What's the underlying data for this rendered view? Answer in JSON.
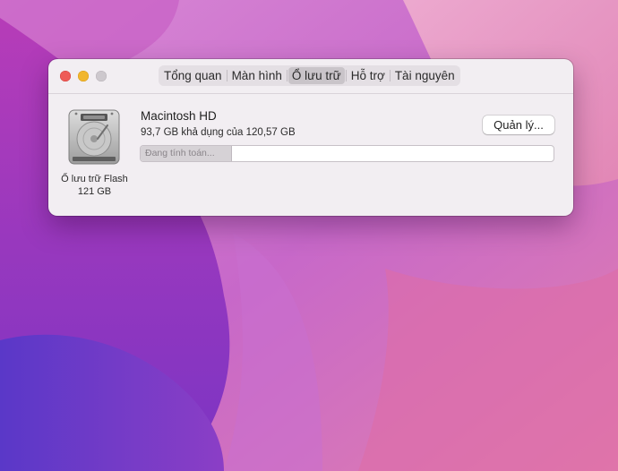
{
  "window": {
    "tabs": [
      {
        "label": "Tổng quan",
        "active": false
      },
      {
        "label": "Màn hình",
        "active": false
      },
      {
        "label": "Ổ lưu trữ",
        "active": true
      },
      {
        "label": "Hỗ trợ",
        "active": false
      },
      {
        "label": "Tài nguyên",
        "active": false
      }
    ]
  },
  "disk": {
    "icon": "hard-drive-icon",
    "type_label": "Ổ lưu trữ Flash",
    "size_label": "121 GB"
  },
  "volume": {
    "name": "Macintosh HD",
    "availability": "93,7 GB khả dụng của 120,57 GB",
    "manage_label": "Quản lý...",
    "bar_status": "Đang tính toán...",
    "bar_fill_fraction": 0.22
  },
  "colors": {
    "close": "#ee5b57",
    "minimize": "#f1b62e",
    "zoom_inactive": "#cdc8cd"
  }
}
